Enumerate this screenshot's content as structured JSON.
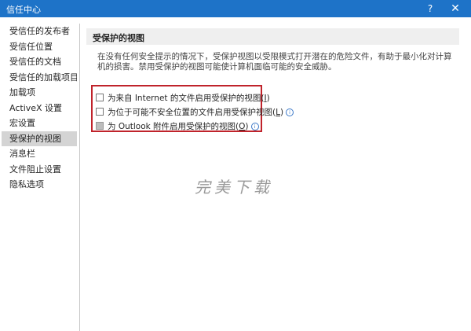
{
  "window": {
    "title": "信任中心",
    "help_label": "?",
    "close_label": "✕"
  },
  "sidebar": {
    "items": [
      {
        "label": "受信任的发布者"
      },
      {
        "label": "受信任位置"
      },
      {
        "label": "受信任的文档"
      },
      {
        "label": "受信任的加载项目录"
      },
      {
        "label": "加载项"
      },
      {
        "label": "ActiveX 设置"
      },
      {
        "label": "宏设置"
      },
      {
        "label": "受保护的视图",
        "selected": true
      },
      {
        "label": "消息栏"
      },
      {
        "label": "文件阻止设置"
      },
      {
        "label": "隐私选项"
      }
    ]
  },
  "panel": {
    "section_title": "受保护的视图",
    "description": "在没有任何安全提示的情况下，受保护视图以受限模式打开潜在的危险文件，有助于最小化对计算机的损害。禁用受保护的视图可能使计算机面临可能的安全威胁。",
    "options": [
      {
        "label": "为来自 Internet 的文件启用受保护的视图(",
        "accel": "I",
        "suffix": ")",
        "checked": false,
        "disabled": false,
        "info": false
      },
      {
        "label": "为位于可能不安全位置的文件启用受保护视图(",
        "accel": "L",
        "suffix": ")",
        "checked": false,
        "disabled": false,
        "info": true
      },
      {
        "label": "为 Outlook 附件启用受保护的视图(",
        "accel": "O",
        "suffix": ")",
        "checked": false,
        "disabled": true,
        "info": true
      }
    ]
  },
  "watermark": "完美下载",
  "icons": {
    "info": "info-icon"
  },
  "colors": {
    "titlebar": "#1e73c8",
    "highlight_border": "#c0232b",
    "selected_item": "#d4d4d4"
  }
}
